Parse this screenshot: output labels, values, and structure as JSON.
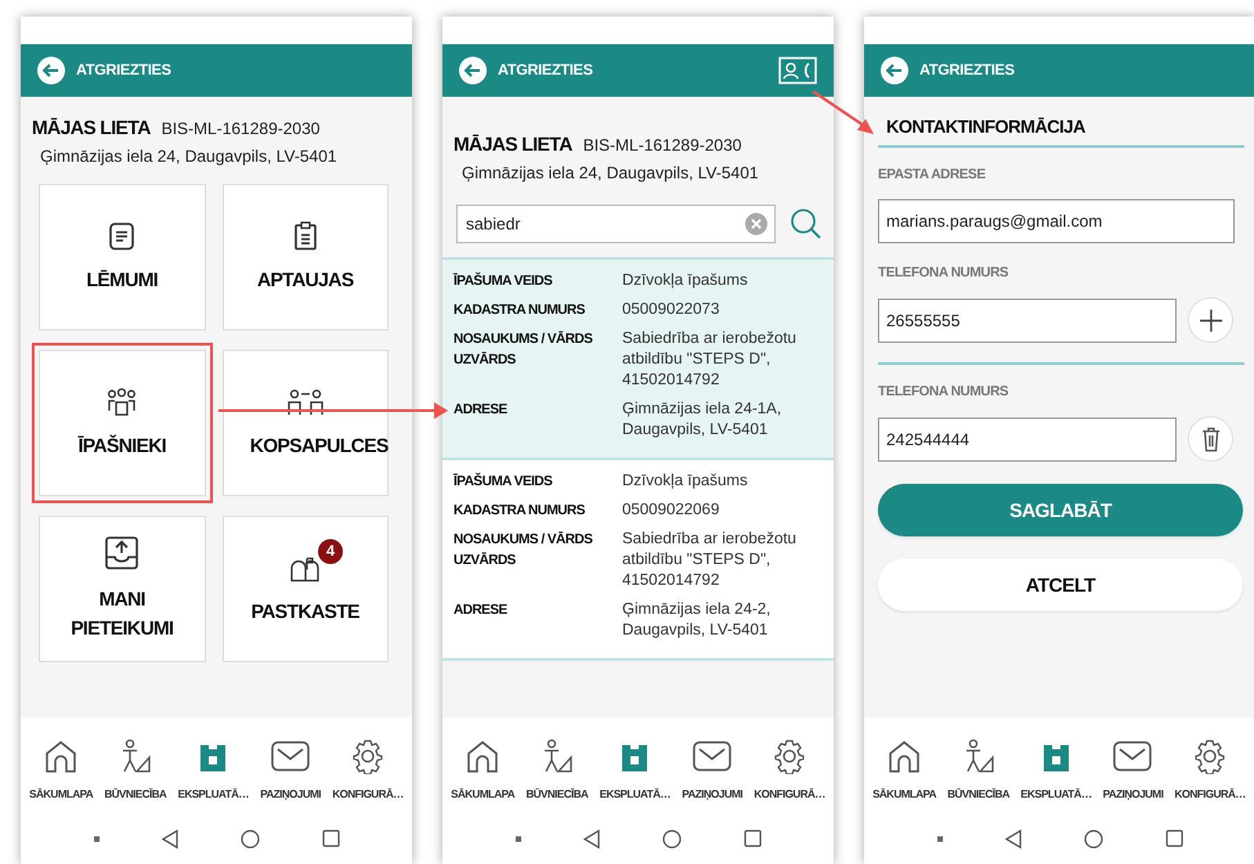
{
  "phones": [
    {
      "kind": "menu",
      "header": {
        "back_label": "ATGRIEZTIES",
        "contact_button": false
      },
      "case": {
        "title": "MĀJAS LIETA",
        "number": "BIS-ML-161289-2030",
        "address": "Ģimnāzijas iela 24, Daugavpils, LV-5401"
      },
      "tiles": [
        {
          "label": "LĒMUMI",
          "highlighted": false
        },
        {
          "label": "APTAUJAS",
          "highlighted": false
        },
        {
          "label": "ĪPAŠNIEKI",
          "highlighted": true
        },
        {
          "label": "KOPSAPULCES",
          "highlighted": false
        },
        {
          "label": "MANI PIETEIKUMI",
          "highlighted": false
        },
        {
          "label": "PASTKASTE",
          "highlighted": false,
          "badge": "4"
        }
      ],
      "nav": [
        {
          "label": "SĀKUMLAPA",
          "selected": false
        },
        {
          "label": "BŪVNIECĪBA",
          "selected": false
        },
        {
          "label": "EKSPLUATĀ…",
          "selected": true
        },
        {
          "label": "PAZIŅOJUMI",
          "selected": false
        },
        {
          "label": "KONFIGURĀ…",
          "selected": false
        }
      ]
    },
    {
      "kind": "search",
      "header": {
        "back_label": "ATGRIEZTIES",
        "contact_button": true
      },
      "case": {
        "title": "MĀJAS LIETA",
        "number": "BIS-ML-161289-2030",
        "address": "Ģimnāzijas iela 24, Daugavpils, LV-5401"
      },
      "search": {
        "value": "sabiedr"
      },
      "results": [
        {
          "selected": true,
          "fields": [
            {
              "label": "ĪPAŠUMA VEIDS",
              "value": "Dzīvokļa īpašums"
            },
            {
              "label": "KADASTRA NUMURS",
              "value": "05009022073"
            },
            {
              "label": "NOSAUKUMS / VĀRDS UZVĀRDS",
              "value": "Sabiedrība ar ierobežotu atbildību \"STEPS D\", 41502014792"
            },
            {
              "label": "ADRESE",
              "value": "Ģimnāzijas iela 24-1A, Daugavpils, LV-5401"
            }
          ]
        },
        {
          "selected": false,
          "fields": [
            {
              "label": "ĪPAŠUMA VEIDS",
              "value": "Dzīvokļa īpašums"
            },
            {
              "label": "KADASTRA NUMURS",
              "value": "05009022069"
            },
            {
              "label": "NOSAUKUMS / VĀRDS UZVĀRDS",
              "value": "Sabiedrība ar ierobežotu atbildību \"STEPS D\", 41502014792"
            },
            {
              "label": "ADRESE",
              "value": "Ģimnāzijas iela 24-2, Daugavpils, LV-5401"
            }
          ]
        }
      ],
      "nav": [
        {
          "label": "SĀKUMLAPA",
          "selected": false
        },
        {
          "label": "BŪVNIECĪBA",
          "selected": false
        },
        {
          "label": "EKSPLUATĀ…",
          "selected": true
        },
        {
          "label": "PAZIŅOJUMI",
          "selected": false
        },
        {
          "label": "KONFIGURĀ…",
          "selected": false
        }
      ]
    },
    {
      "kind": "contact",
      "header": {
        "back_label": "ATGRIEZTIES",
        "contact_button": false
      },
      "section_title": "KONTAKTINFORMĀCIJA",
      "fields": [
        {
          "kind": "email",
          "label": "EPASTA ADRESE",
          "value": "marians.paraugs@gmail.com"
        },
        {
          "kind": "phone-add",
          "label": "TELEFONA NUMURS",
          "value": "26555555"
        },
        {
          "kind": "phone-remove",
          "label": "TELEFONA NUMURS",
          "value": "242544444"
        }
      ],
      "buttons": [
        {
          "label": "SAGLABĀT",
          "primary": true
        },
        {
          "label": "ATCELT",
          "primary": false
        }
      ],
      "nav": [
        {
          "label": "SĀKUMLAPA",
          "selected": false
        },
        {
          "label": "BŪVNIECĪBA",
          "selected": false
        },
        {
          "label": "EKSPLUATĀ…",
          "selected": true
        },
        {
          "label": "PAZIŅOJUMI",
          "selected": false
        },
        {
          "label": "KONFIGURĀ…",
          "selected": false
        }
      ]
    }
  ]
}
